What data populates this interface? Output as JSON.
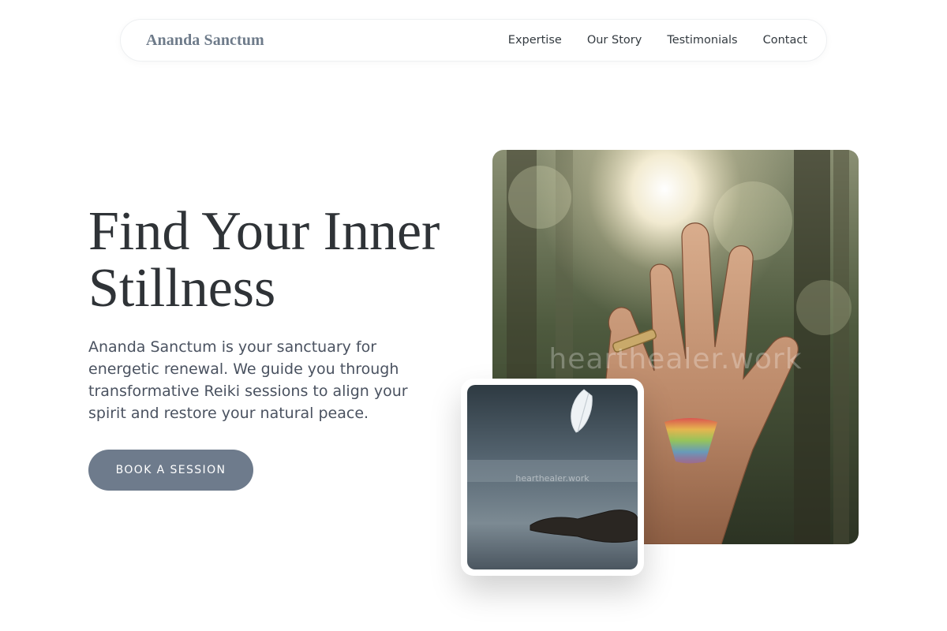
{
  "nav": {
    "brand": "Ananda Sanctum",
    "links": [
      "Expertise",
      "Our Story",
      "Testimonials",
      "Contact"
    ]
  },
  "hero": {
    "title_line1": "Find Your Inner",
    "title_line2": "Stillness",
    "description": "Ananda Sanctum is your sanctuary for energetic renewal. We guide you through transformative Reiki sessions to align your spirit and restore your natural peace.",
    "cta_label": "BOOK A SESSION"
  },
  "images": {
    "main_watermark": "hearthealer.work",
    "small_watermark": "hearthealer.work"
  },
  "colors": {
    "accent": "#6e7b8c",
    "brand": "#6e7b8a",
    "text": "#2f3337"
  }
}
